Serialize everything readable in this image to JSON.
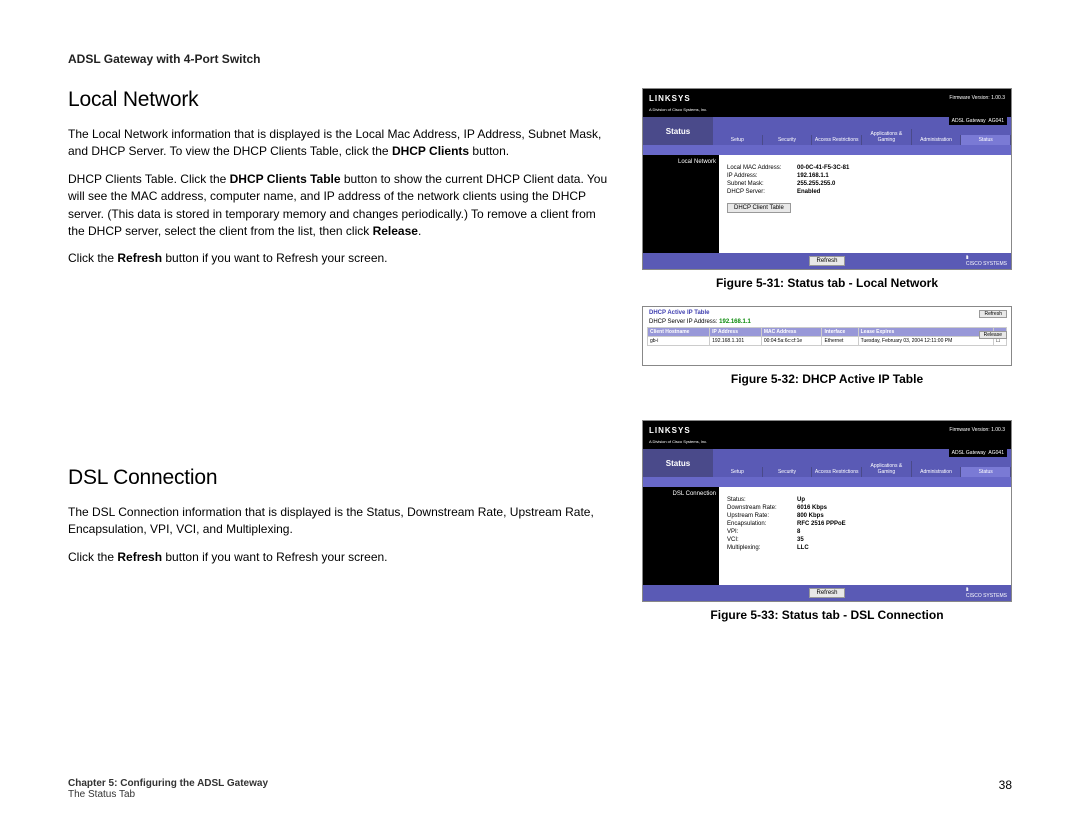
{
  "header": "ADSL Gateway with 4-Port Switch",
  "section1": {
    "title": "Local Network",
    "p1a": "The Local Network information that is displayed is the Local Mac Address, IP Address, Subnet Mask, and DHCP Server. To view the DHCP Clients Table, click the ",
    "p1b": "DHCP Clients",
    "p1c": " button.",
    "p2a": "DHCP Clients Table. Click the ",
    "p2b": "DHCP Clients Table",
    "p2c": " button to show the current DHCP Client data. You will see the MAC address, computer name, and IP address of the network clients using the DHCP server. (This data is stored in temporary memory and changes periodically.) To remove a client from the DHCP server, select the client from the list, then click ",
    "p2d": "Release",
    "p2e": ".",
    "p3a": "Click the ",
    "p3b": "Refresh",
    "p3c": " button if you want to Refresh your screen."
  },
  "section2": {
    "title": "DSL Connection",
    "p1": "The DSL Connection information that is displayed is the Status, Downstream Rate, Upstream Rate, Encapsulation, VPI, VCI, and Multiplexing.",
    "p2a": "Click the ",
    "p2b": "Refresh",
    "p2c": " button if you want to Refresh your screen."
  },
  "figures": {
    "f1": "Figure 5-31: Status tab - Local Network",
    "f2": "Figure 5-32: DHCP Active IP Table",
    "f3": "Figure 5-33: Status tab - DSL Connection"
  },
  "footer": {
    "chapter": "Chapter 5: Configuring the ADSL Gateway",
    "sub": "The Status Tab",
    "page": "38"
  },
  "shot_common": {
    "logo": "LINKSYS",
    "division": "A Division of Cisco Systems, Inc.",
    "firmware": "Firmware Version: 1.00.3",
    "gateway_label": "ADSL Gateway",
    "model": "AG041",
    "nav_status": "Status",
    "tabs": [
      "Setup",
      "Security",
      "Access Restrictions",
      "Applications & Gaming",
      "Administration",
      "Status"
    ],
    "refresh": "Refresh",
    "cisco": "CISCO SYSTEMS"
  },
  "shot1": {
    "side": "Local Network",
    "rows": [
      {
        "k": "Local MAC Address:",
        "v": "00-0C-41-F5-3C-81"
      },
      {
        "k": "IP Address:",
        "v": "192.168.1.1"
      },
      {
        "k": "Subnet Mask:",
        "v": "255.255.255.0"
      },
      {
        "k": "DHCP Server:",
        "v": "Enabled"
      }
    ],
    "btn": "DHCP Client Table"
  },
  "shot2": {
    "title": "DHCP Active IP Table",
    "server_label": "DHCP Server IP Address:",
    "server_ip": "192.168.1.1",
    "refresh": "Refresh",
    "release": "Release",
    "cols": [
      "Client Hostname",
      "IP Address",
      "MAC Address",
      "Interface",
      "Lease Expires"
    ],
    "row": [
      "gb-i",
      "192.168.1.101",
      "00:04:5a:6c:cf:1e",
      "Ethernet",
      "Tuesday, February 03, 2004 12:11:00 PM"
    ]
  },
  "shot3": {
    "side": "DSL Connection",
    "rows": [
      {
        "k": "Status:",
        "v": "Up"
      },
      {
        "k": "Downstream Rate:",
        "v": "6016 Kbps"
      },
      {
        "k": "Upstream Rate:",
        "v": "800 Kbps"
      },
      {
        "k": "Encapsulation:",
        "v": "RFC 2516 PPPoE"
      },
      {
        "k": "VPI:",
        "v": "8"
      },
      {
        "k": "VCI:",
        "v": "35"
      },
      {
        "k": "Multiplexing:",
        "v": "LLC"
      }
    ]
  }
}
